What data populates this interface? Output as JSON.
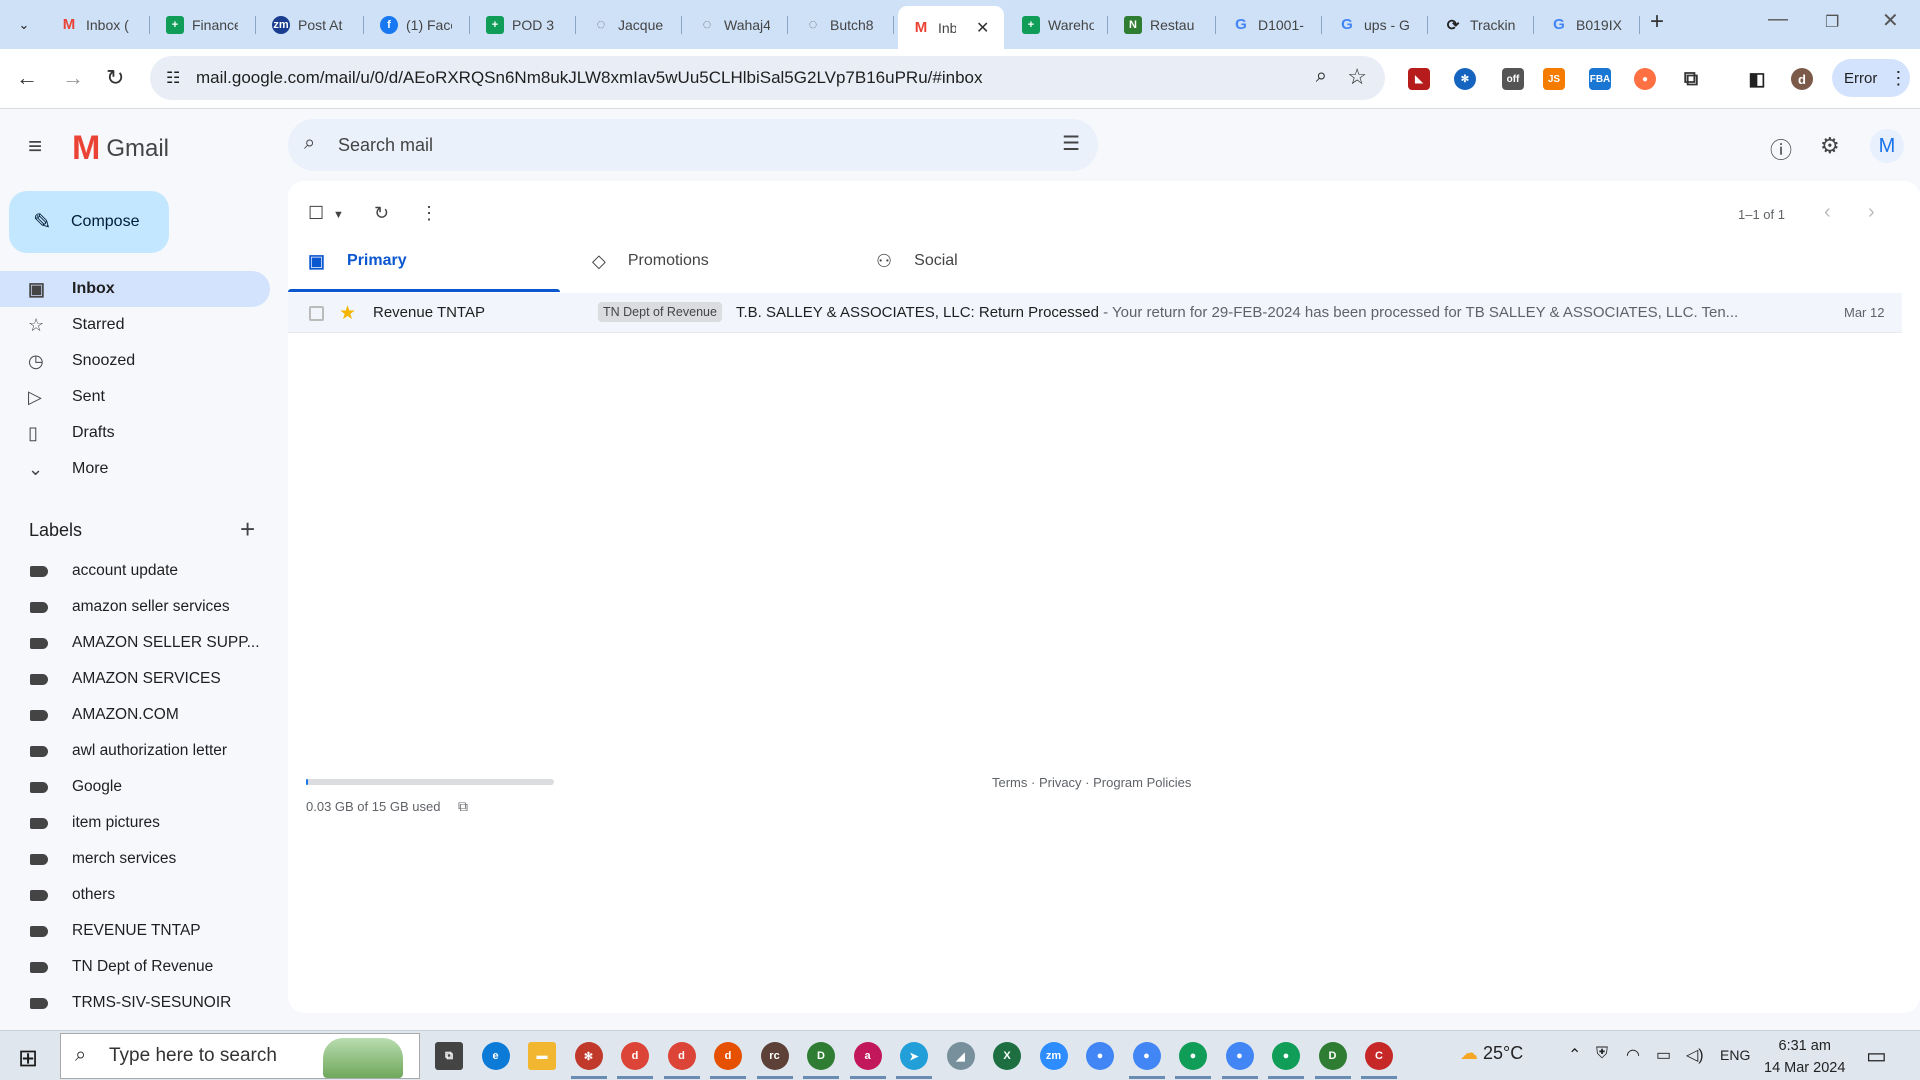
{
  "browser": {
    "tabs": [
      {
        "title": "Inbox (",
        "favicon": "gmail-icon",
        "color": "#ea4335"
      },
      {
        "title": "Finance",
        "favicon": "sheets-icon",
        "color": "#0f9d58"
      },
      {
        "title": "Post At",
        "favicon": "zm-icon",
        "color": "#1a3d8f"
      },
      {
        "title": "(1) Face",
        "favicon": "facebook-icon",
        "color": "#1877f2"
      },
      {
        "title": "POD 3",
        "favicon": "sheets-icon",
        "color": "#0f9d58"
      },
      {
        "title": "Jacque",
        "favicon": "globe-icon",
        "color": "#5f6368"
      },
      {
        "title": "Wahaj4",
        "favicon": "globe-icon",
        "color": "#5f6368"
      },
      {
        "title": "Butch8",
        "favicon": "globe-icon",
        "color": "#5f6368"
      },
      {
        "title": "Inb",
        "favicon": "gmail-icon",
        "color": "#ea4335",
        "active": true
      },
      {
        "title": "Wareho",
        "favicon": "sheets-icon",
        "color": "#0f9d58"
      },
      {
        "title": "Restau",
        "favicon": "n-icon",
        "color": "#2e7d32"
      },
      {
        "title": "D1001-",
        "favicon": "google-icon",
        "color": "#4285f4"
      },
      {
        "title": "ups - G",
        "favicon": "google-icon",
        "color": "#4285f4"
      },
      {
        "title": "Trackin",
        "favicon": "tracking-icon",
        "color": "#222222"
      },
      {
        "title": "B019IX",
        "favicon": "google-icon",
        "color": "#4285f4"
      }
    ],
    "url": "mail.google.com/mail/u/0/d/AEoRXRQSn6Nm8ukJLW8xmIav5wUu5CLHlbiSal5G2LVp7B16uPRu/#inbox",
    "error_button": "Error",
    "profile_letter": "d"
  },
  "gmail": {
    "brand": "Gmail",
    "search_placeholder": "Search mail",
    "avatar_letter": "M",
    "compose": "Compose",
    "nav": [
      {
        "label": "Inbox",
        "icon": "inbox-icon",
        "glyph": "▣",
        "selected": true
      },
      {
        "label": "Starred",
        "icon": "star-icon",
        "glyph": "☆"
      },
      {
        "label": "Snoozed",
        "icon": "clock-icon",
        "glyph": "◷"
      },
      {
        "label": "Sent",
        "icon": "send-icon",
        "glyph": "▷"
      },
      {
        "label": "Drafts",
        "icon": "draft-icon",
        "glyph": "▯"
      },
      {
        "label": "More",
        "icon": "chevron-down-icon",
        "glyph": "⌄"
      }
    ],
    "labels_heading": "Labels",
    "labels": [
      "account update",
      "amazon seller services",
      "AMAZON SELLER SUPP...",
      "AMAZON SERVICES",
      "AMAZON.COM",
      "awl authorization letter",
      "Google",
      "item pictures",
      "merch services",
      "others",
      "REVENUE TNTAP",
      "TN Dept of Revenue",
      "TRMS-SIV-SESUNOIR"
    ],
    "pager": "1–1 of 1",
    "category_tabs": [
      {
        "label": "Primary",
        "icon": "inbox-icon",
        "selected": true
      },
      {
        "label": "Promotions",
        "icon": "tag-icon"
      },
      {
        "label": "Social",
        "icon": "people-icon"
      }
    ],
    "emails": [
      {
        "sender": "Revenue TNTAP",
        "label_chip": "TN Dept of Revenue",
        "subject": "T.B. SALLEY & ASSOCIATES, LLC: Return Processed",
        "snippet": " - Your return for 29-FEB-2024 has been processed for TB SALLEY & ASSOCIATES, LLC. Ten...",
        "date": "Mar 12",
        "starred": true
      }
    ],
    "storage": "0.03 GB of 15 GB used",
    "storage_fraction": 0.002,
    "footer": "Terms · Privacy · Program Policies"
  },
  "taskbar": {
    "search_placeholder": "Type here to search",
    "temperature": "25°C",
    "language": "ENG",
    "time": "6:31 am",
    "date": "14 Mar 2024"
  }
}
